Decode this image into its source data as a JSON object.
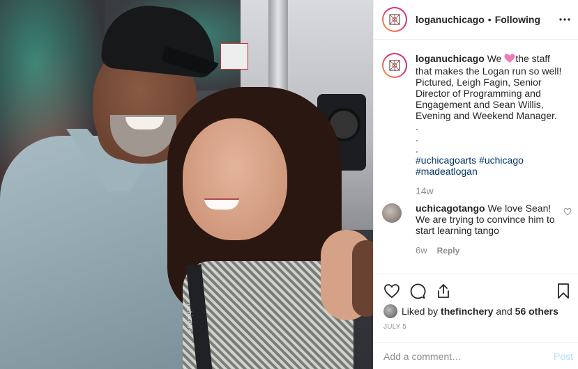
{
  "header": {
    "username": "loganuchicago",
    "separator": "•",
    "follow_status": "Following",
    "more_icon": "more-horizontal-icon"
  },
  "photo": {
    "lanyard_text": "uchicago"
  },
  "caption": {
    "username": "loganuchicago",
    "text_before_emoji": "We ",
    "emoji": "pink-heart-icon",
    "text_after_emoji": "the staff that makes the Logan run so well! Pictured, Leigh Fagin, Senior Director of Programming and Engagement and Sean Willis, Evening and Weekend Manager.",
    "dots": [
      ".",
      ".",
      "."
    ],
    "hashtags": [
      "#uchicagoarts",
      "#uchicago",
      "#madeatlogan"
    ],
    "time": "14w"
  },
  "comment": {
    "username": "uchicagotango",
    "text": "We love Sean! We are trying to convince him to start learning tango",
    "time": "6w",
    "reply_label": "Reply",
    "like_icon": "heart-outline-icon"
  },
  "actions": {
    "like_icon": "heart-outline-icon",
    "comment_icon": "comment-bubble-icon",
    "share_icon": "share-icon",
    "save_icon": "bookmark-icon"
  },
  "likes": {
    "prefix": "Liked by ",
    "user": "thefinchery",
    "middle": " and ",
    "others": "56 others"
  },
  "date": "JULY 5",
  "add_comment": {
    "placeholder": "Add a comment…",
    "post_label": "Post"
  },
  "colors": {
    "link": "#003569",
    "muted": "#8e8e8e",
    "post_disabled": "#b2dffc",
    "heart": "#ed4956"
  }
}
